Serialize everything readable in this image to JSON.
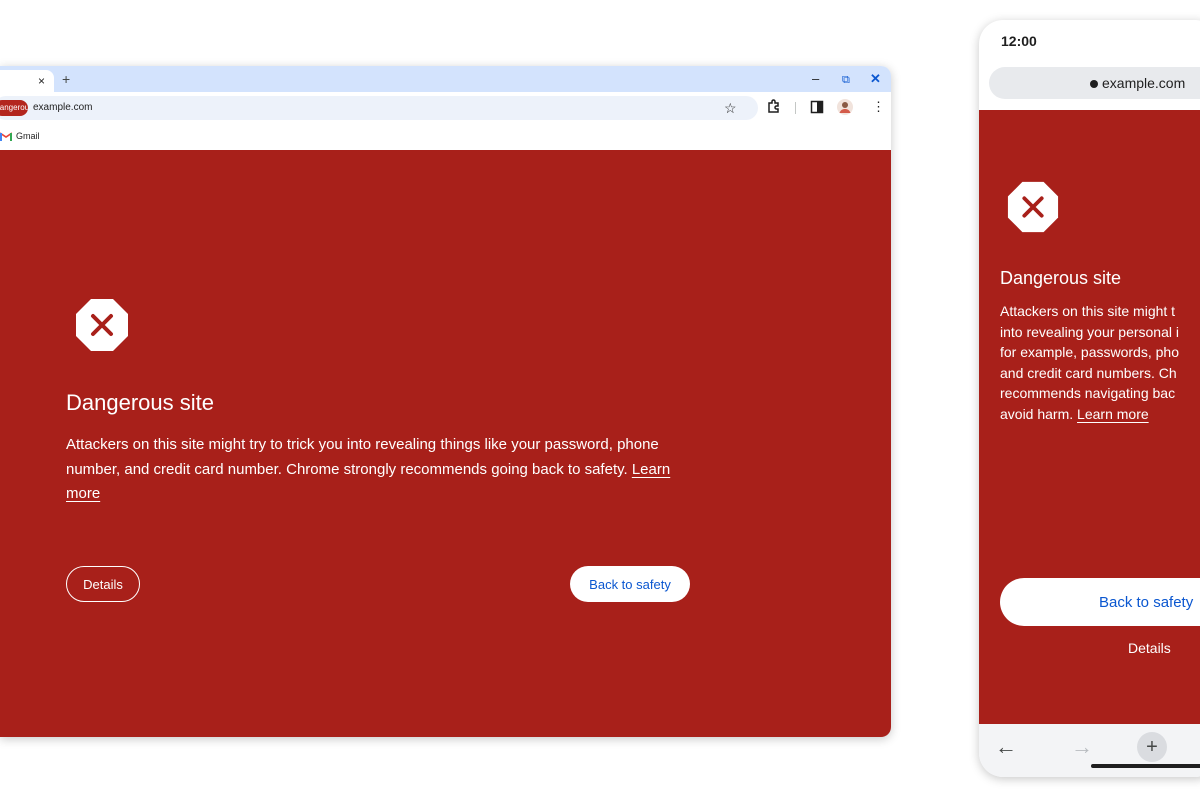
{
  "desktop": {
    "tab": {
      "close_glyph": "×"
    },
    "new_tab_glyph": "+",
    "window_controls": {
      "minimize": "–",
      "restore": "⧉",
      "close": "✕"
    },
    "omnibox": {
      "security_chip": "Dangerous",
      "url": "example.com"
    },
    "toolbar_icons": [
      "star-icon",
      "extensions-icon",
      "side-panel-icon",
      "profile-avatar",
      "menu-icon"
    ],
    "menu_glyph": "⋮",
    "star_glyph": "☆",
    "bookmarks": [
      {
        "label": "Gmail",
        "icon": "gmail-icon"
      }
    ],
    "interstitial": {
      "icon": "dangerous-x-octagon-icon",
      "title": "Dangerous site",
      "body": "Attackers on this site might try to trick you into revealing things like your password, phone number, and credit card number. Chrome strongly recommends going back to safety.",
      "learn_more": "Learn more",
      "details_button": "Details",
      "back_button": "Back to safety"
    }
  },
  "mobile": {
    "time": "12:00",
    "url": "example.com",
    "interstitial": {
      "icon": "dangerous-x-octagon-icon",
      "title": "Dangerous site",
      "body_lines": [
        "Attackers on this site might t",
        "into revealing your personal i",
        "for example, passwords, pho",
        "and credit card numbers. Ch",
        "recommends navigating bac",
        "avoid harm."
      ],
      "learn_more": "Learn more",
      "back_button": "Back to safety",
      "details_link": "Details"
    },
    "nav": {
      "back": "←",
      "forward": "→",
      "new_tab": "+"
    }
  },
  "colors": {
    "danger_red": "#a8201a",
    "chip_red": "#b3261e",
    "tabstrip_blue": "#d3e3fd",
    "link_blue": "#0b57d0",
    "omnibox_bg": "#edf2fa"
  }
}
